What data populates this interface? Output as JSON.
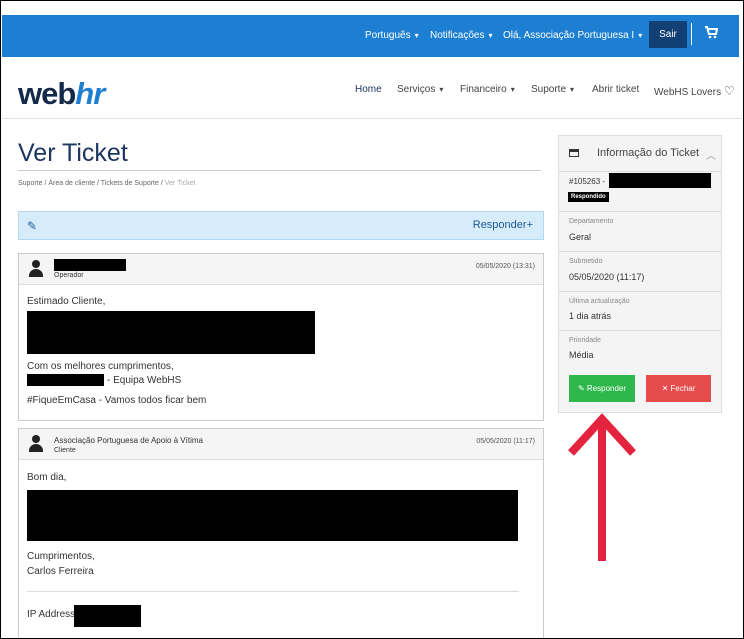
{
  "topbar": {
    "language": "Português",
    "notifications": "Notificações",
    "greeting": "Olá, Associação Portuguesa I",
    "logout": "Sair",
    "cart_icon": "cart-icon"
  },
  "logo": {
    "part1": "web",
    "part2": "hr"
  },
  "nav": {
    "home": "Home",
    "services": "Serviços",
    "financial": "Financeiro",
    "support": "Suporte",
    "open_ticket": "Abrir ticket",
    "lovers": "WebHS Lovers"
  },
  "page": {
    "title": "Ver Ticket",
    "breadcrumb": [
      "Suporte",
      "Área de cliente",
      "Tickets de Suporte",
      "Ver Ticket"
    ],
    "reply_label": "Responder+"
  },
  "messages": [
    {
      "role": "Operador",
      "date": "05/05/2020 (13:31)",
      "greeting": "Estimado Cliente,",
      "closing": "Com os melhores cumprimentos,",
      "signature": "- Equipa WebHS",
      "tagline": "#FiqueEmCasa - Vamos todos ficar bem"
    },
    {
      "author": "Associação Portuguesa de Apoio à Vítima",
      "role": "Cliente",
      "date": "05/05/2020 (11:17)",
      "greeting": "Bom dia,",
      "closing": "Cumprimentos,",
      "name": "Carlos Ferreira",
      "ip_label": "IP Address:"
    }
  ],
  "sidebar": {
    "title": "Informação do Ticket",
    "ticket_id": "#105263 -",
    "status": "Respondido",
    "department_label": "Departamento",
    "department": "Geral",
    "submitted_label": "Submetido",
    "submitted": "05/05/2020 (11:17)",
    "updated_label": "Última actualização",
    "updated": "1 dia atrás",
    "priority_label": "Prioridade",
    "priority": "Média",
    "reply_button": "Responder",
    "close_button": "Fechar"
  },
  "colors": {
    "topbar": "#1d7fd1",
    "reply_button": "#2eb84b",
    "close_button": "#e74c4c",
    "arrow": "#e4243f"
  }
}
